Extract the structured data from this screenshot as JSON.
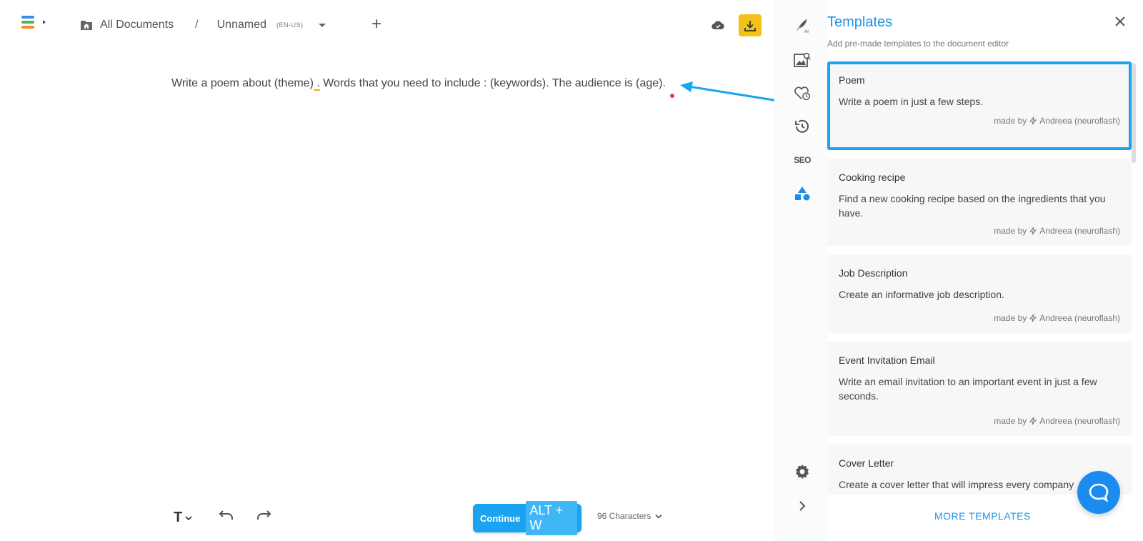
{
  "header": {
    "folder_label": "All Documents",
    "separator": "/",
    "doc_name": "Unnamed",
    "lang": "(EN-US)"
  },
  "editor": {
    "text_part1": "Write a poem about (theme)",
    "text_part2": " .",
    "text_part3": " Words that you need to include : (keywords). The audience is (age)."
  },
  "toolbar": {
    "format_label": "T",
    "continue_label": "Continue",
    "continue_shortcut": "ALT + W",
    "char_count": "96 Characters"
  },
  "rail": {
    "seo_label": "SEO",
    "ai_badge": "AI"
  },
  "panel": {
    "title": "Templates",
    "subtitle": "Add pre-made templates to the document editor",
    "more_label": "MORE TEMPLATES",
    "templates": [
      {
        "name": "Poem",
        "desc": "Write a poem in just a few steps.",
        "made_by": "made by",
        "author": "Andreea (neuroflash)"
      },
      {
        "name": "Cooking recipe",
        "desc": "Find a new cooking recipe based on the ingredients that you have.",
        "made_by": "made by",
        "author": "Andreea (neuroflash)"
      },
      {
        "name": "Job Description",
        "desc": "Create an informative job description.",
        "made_by": "made by",
        "author": "Andreea (neuroflash)"
      },
      {
        "name": "Event Invitation Email",
        "desc": "Write an email invitation to an important event in just a few seconds.",
        "made_by": "made by",
        "author": "Andreea (neuroflash)"
      },
      {
        "name": "Cover Letter",
        "desc": "Create a cover letter that will impress every company",
        "made_by": "",
        "author": ""
      }
    ]
  },
  "colors": {
    "accent": "#19a3f0",
    "title_blue": "#1b96e6",
    "download_yellow": "#f2c21a",
    "cursor_pink": "#e8337e"
  }
}
